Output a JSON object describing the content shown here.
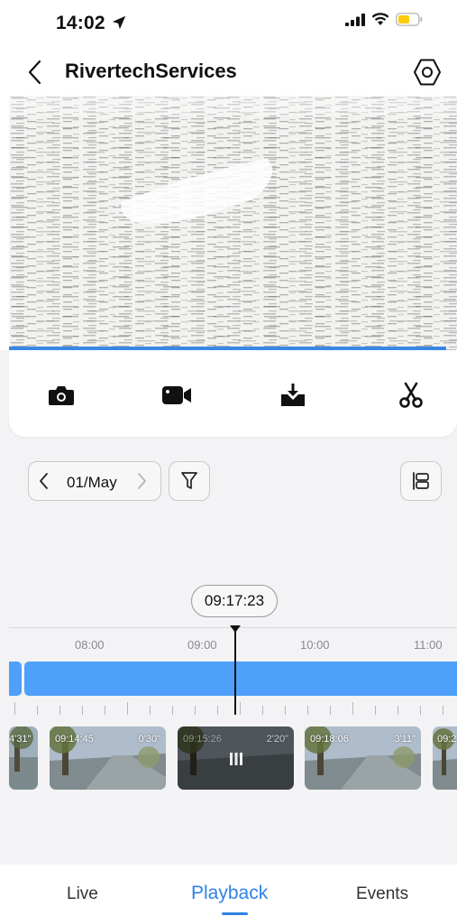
{
  "status_bar": {
    "time": "14:02"
  },
  "header": {
    "title": "RivertechServices"
  },
  "toolbar": {
    "items": [
      "camera-icon",
      "video-record-icon",
      "download-icon",
      "scissors-icon"
    ]
  },
  "date_selector": {
    "date": "01/May"
  },
  "timeline": {
    "current_time": "09:17:23",
    "tick_labels": [
      "08:00",
      "09:00",
      "10:00",
      "11:00"
    ]
  },
  "clips": [
    {
      "time": "",
      "duration": "4'31\""
    },
    {
      "time": "09:14:45",
      "duration": "0'30\""
    },
    {
      "time": "09:15:26",
      "duration": "2'20\"",
      "playing": true
    },
    {
      "time": "09:18:06",
      "duration": "3'11\""
    },
    {
      "time": "09:2",
      "duration": ""
    }
  ],
  "bottom_nav": {
    "live": "Live",
    "playback": "Playback",
    "events": "Events",
    "active": "Playback"
  },
  "colors": {
    "accent": "#2f82e6",
    "recording_bar": "#4fa0fb"
  }
}
